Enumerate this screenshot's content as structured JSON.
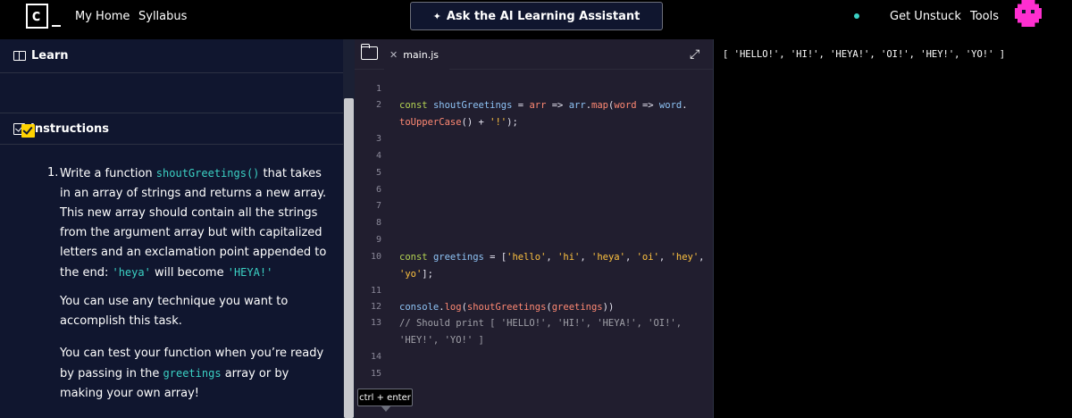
{
  "nav": {
    "logo_char": "c",
    "my_home": "My Home",
    "syllabus": "Syllabus",
    "ai_assistant": "Ask the AI Learning Assistant",
    "get_unstuck": "Get Unstuck",
    "tools": "Tools"
  },
  "left": {
    "learn_label": "Learn",
    "instructions_label": "Instructions",
    "task_number": "1.",
    "task_text_1": "Write a function ",
    "task_code_1": "shoutGreetings()",
    "task_text_2": " that takes in an array of strings and returns a new array. This new array should contain all the strings from the argument array but with capitalized letters and an exclamation point appended to the end: ",
    "task_code_2": "'heya'",
    "task_text_3": " will become ",
    "task_code_3": "'HEYA!'",
    "para_1": "You can use any technique you want to accomplish this task.",
    "para_2a": "You can test your function when you’re ready by passing in the ",
    "para_2_code": "greetings",
    "para_2b": " array or by making your own array!"
  },
  "editor": {
    "tab_name": "main.js",
    "hint": "ctrl + enter",
    "line_numbers": [
      "1",
      "2",
      "3",
      "4",
      "5",
      "6",
      "7",
      "8",
      "9",
      "10",
      "11",
      "12",
      "13",
      "14",
      "15"
    ]
  },
  "output": {
    "text": "[ 'HELLO!', 'HI!', 'HEYA!', 'OI!', 'HEY!', 'YO!' ]"
  },
  "colors": {
    "nav_bg": "#000000",
    "left_bg": "#10162f",
    "editor_bg": "#211e2f",
    "accent_yellow": "#ffd300",
    "accent_teal": "#3bd1c4",
    "avatar_pink": "#ff2fd0"
  },
  "icons": [
    "logo-icon",
    "sparkle-icon",
    "status-dot-icon",
    "avatar-icon",
    "book-icon",
    "checkbox-icon",
    "task-complete-icon",
    "folder-icon",
    "close-icon",
    "expand-icon"
  ]
}
